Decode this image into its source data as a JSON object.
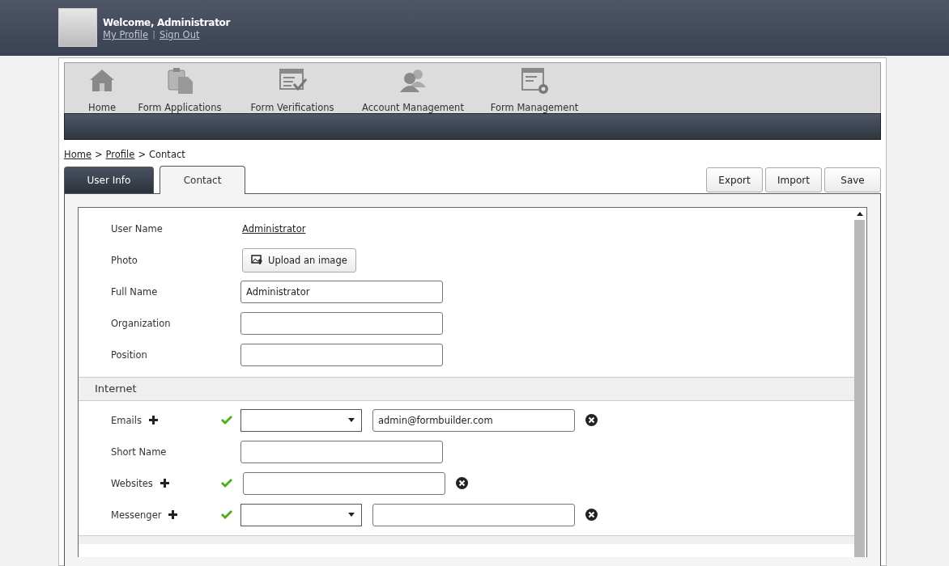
{
  "header": {
    "welcome": "Welcome, Administrator",
    "links": [
      "My Profile",
      "Sign Out"
    ],
    "separator": "|"
  },
  "nav": [
    {
      "label": "Home"
    },
    {
      "label": "Form Applications"
    },
    {
      "label": "Form Verifications"
    },
    {
      "label": "Account Management"
    },
    {
      "label": "Form Management"
    }
  ],
  "breadcrumb": {
    "links": [
      "Home",
      "Profile"
    ],
    "separator": ">",
    "current": "Contact"
  },
  "tabs": [
    {
      "label": "User Info",
      "selected": false
    },
    {
      "label": "Contact",
      "selected": true
    }
  ],
  "buttons": [
    "Export",
    "Import",
    "Save"
  ],
  "profile_fields": [
    {
      "label": "User Name",
      "kind": "link",
      "value": "Administrator"
    },
    {
      "label": "Photo",
      "kind": "upload",
      "value": "Upload an image"
    },
    {
      "label": "Full Name",
      "kind": "text",
      "value": "Administrator"
    },
    {
      "label": "Organization",
      "kind": "text"
    },
    {
      "label": "Position",
      "kind": "text"
    }
  ],
  "internet": {
    "title": "Internet",
    "fields": [
      {
        "label": "Emails",
        "kind": "select-text",
        "addable": true,
        "value": "admin@formbuilder.com"
      },
      {
        "label": "Short Name",
        "kind": "text",
        "addable": false
      },
      {
        "label": "Websites",
        "kind": "text-remove",
        "addable": true
      },
      {
        "label": "Messenger",
        "kind": "select-text",
        "addable": true
      }
    ]
  }
}
